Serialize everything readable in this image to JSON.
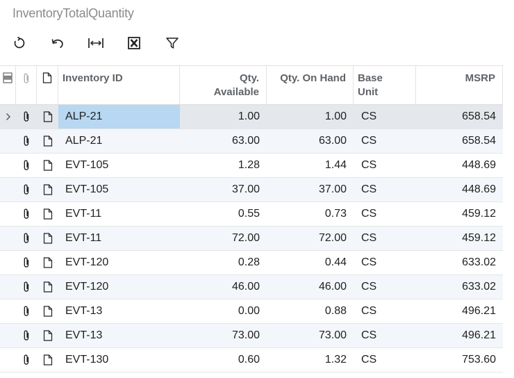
{
  "screen": {
    "title": "InventoryTotalQuantity"
  },
  "toolbar": {
    "buttons": [
      {
        "name": "refresh-button",
        "icon": "refresh-icon"
      },
      {
        "name": "undo-button",
        "icon": "undo-icon"
      },
      {
        "name": "fit-columns-button",
        "icon": "fit-width-icon"
      },
      {
        "name": "export-excel-button",
        "icon": "excel-icon"
      },
      {
        "name": "filter-button",
        "icon": "filter-icon"
      }
    ]
  },
  "columns": {
    "inventory_id": "Inventory ID",
    "qty_available_line1": "Qty.",
    "qty_available_line2": "Available",
    "qty_on_hand": "Qty. On Hand",
    "base_unit_line1": "Base",
    "base_unit_line2": "Unit",
    "msrp": "MSRP"
  },
  "rows": [
    {
      "inventory_id": "ALP-21",
      "qty_available": "1.00",
      "qty_on_hand": "1.00",
      "base_unit": "CS",
      "msrp": "658.54"
    },
    {
      "inventory_id": "ALP-21",
      "qty_available": "63.00",
      "qty_on_hand": "63.00",
      "base_unit": "CS",
      "msrp": "658.54"
    },
    {
      "inventory_id": "EVT-105",
      "qty_available": "1.28",
      "qty_on_hand": "1.44",
      "base_unit": "CS",
      "msrp": "448.69"
    },
    {
      "inventory_id": "EVT-105",
      "qty_available": "37.00",
      "qty_on_hand": "37.00",
      "base_unit": "CS",
      "msrp": "448.69"
    },
    {
      "inventory_id": "EVT-11",
      "qty_available": "0.55",
      "qty_on_hand": "0.73",
      "base_unit": "CS",
      "msrp": "459.12"
    },
    {
      "inventory_id": "EVT-11",
      "qty_available": "72.00",
      "qty_on_hand": "72.00",
      "base_unit": "CS",
      "msrp": "459.12"
    },
    {
      "inventory_id": "EVT-120",
      "qty_available": "0.28",
      "qty_on_hand": "0.44",
      "base_unit": "CS",
      "msrp": "633.02"
    },
    {
      "inventory_id": "EVT-120",
      "qty_available": "46.00",
      "qty_on_hand": "46.00",
      "base_unit": "CS",
      "msrp": "633.02"
    },
    {
      "inventory_id": "EVT-13",
      "qty_available": "0.00",
      "qty_on_hand": "0.88",
      "base_unit": "CS",
      "msrp": "496.21"
    },
    {
      "inventory_id": "EVT-13",
      "qty_available": "73.00",
      "qty_on_hand": "73.00",
      "base_unit": "CS",
      "msrp": "496.21"
    },
    {
      "inventory_id": "EVT-130",
      "qty_available": "0.60",
      "qty_on_hand": "1.32",
      "base_unit": "CS",
      "msrp": "753.60"
    }
  ],
  "active_row": 0,
  "colors": {
    "selected_cell": "#b7d7f2",
    "active_row": "#e4e7eb",
    "alt_row": "#f3f6fb"
  }
}
